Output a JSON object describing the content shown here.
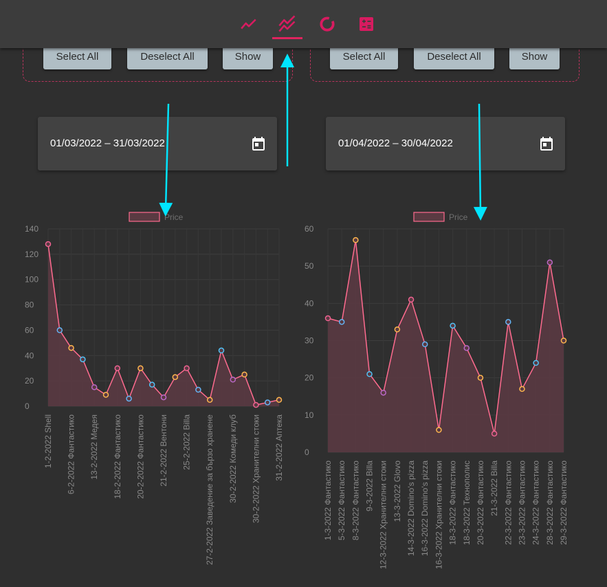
{
  "nav": {
    "icons": [
      "line-chart-icon",
      "multi-line-chart-icon",
      "donut-chart-icon",
      "calculator-icon"
    ],
    "active_icon": "multi-line-chart-icon",
    "accent_color": "#e0245e"
  },
  "left_panel": {
    "select_all": "Select All",
    "deselect_all": "Deselect All",
    "show": "Show",
    "date_range": "01/03/2022 – 31/03/2022"
  },
  "right_panel": {
    "select_all": "Select All",
    "deselect_all": "Deselect All",
    "show": "Show",
    "date_range": "01/04/2022 – 30/04/2022"
  },
  "annotation_color": "#00e5ff",
  "chart_data": [
    {
      "type": "area",
      "legend": "Price",
      "ylim": [
        0,
        140
      ],
      "yticks": [
        0,
        20,
        40,
        60,
        80,
        100,
        120,
        140
      ],
      "grid": true,
      "x": [
        "1-2-2022 Shell",
        "",
        "6-2-2022 Фантастико",
        "",
        "13-2-2022 Медея",
        "",
        "18-2-2022 Фантастико",
        "",
        "20-2-2022 Фантастико",
        "",
        "21-2-2022 Вентони",
        "",
        "25-2-2022 Billa",
        "",
        "27-2-2022 Заведение за бързо хранене",
        "",
        "30-2-2022 Комеди клуб",
        "",
        "30-2-2022 Хранителни стоки",
        "",
        "31-2-2022 Аптека"
      ],
      "values": [
        128,
        60,
        46,
        37,
        15,
        9,
        30,
        6,
        30,
        17,
        7,
        23,
        30,
        13,
        5,
        44,
        21,
        25,
        1,
        3,
        5
      ],
      "point_colors": [
        "#f06292",
        "#64b5f6",
        "#ffb74d",
        "#4fc3f7",
        "#ba68c8",
        "#ffb74d",
        "#f06292",
        "#64b5f6",
        "#ffb74d",
        "#4fc3f7",
        "#ba68c8",
        "#ffb74d",
        "#f06292",
        "#64b5f6",
        "#ffb74d",
        "#4fc3f7",
        "#ba68c8",
        "#ffb74d",
        "#f06292",
        "#64b5f6",
        "#ffb74d"
      ],
      "line_color": "#ff6b8f",
      "fill_color": "#5a3a42"
    },
    {
      "type": "area",
      "legend": "Price",
      "ylim": [
        0,
        60
      ],
      "yticks": [
        0,
        10,
        20,
        30,
        40,
        50,
        60
      ],
      "grid": true,
      "x": [
        "1-3-2022 Фантастико",
        "5-3-2022 Фантастико",
        "8-3-2022 Фантастико",
        "9-3-2022 Billa",
        "12-3-2022 Хранителни стоки",
        "13-3-2022 Glovo",
        "14-3-2022 Domino's pizza",
        "16-3-2022 Domino's pizza",
        "16-3-2022 Хранителни стоки",
        "18-3-2022 Фантастико",
        "18-3-2022 Технополис",
        "20-3-2022 Фантастико",
        "21-3-2022 Billa",
        "22-3-2022 Фантастико",
        "23-3-2022 Фантастико",
        "24-3-2022 Фантастико",
        "28-3-2022 Фантастико",
        "29-3-2022 Фантастико"
      ],
      "values": [
        36,
        35,
        57,
        21,
        16,
        33,
        41,
        29,
        6,
        34,
        28,
        20,
        5,
        35,
        17,
        24,
        51,
        30
      ],
      "point_colors": [
        "#f06292",
        "#64b5f6",
        "#ffb74d",
        "#4fc3f7",
        "#ba68c8",
        "#ffb74d",
        "#f06292",
        "#64b5f6",
        "#ffb74d",
        "#4fc3f7",
        "#ba68c8",
        "#ffb74d",
        "#f06292",
        "#64b5f6",
        "#ffb74d",
        "#4fc3f7",
        "#ba68c8",
        "#ffb74d"
      ],
      "line_color": "#ff6b8f",
      "fill_color": "#5a3a42"
    }
  ]
}
